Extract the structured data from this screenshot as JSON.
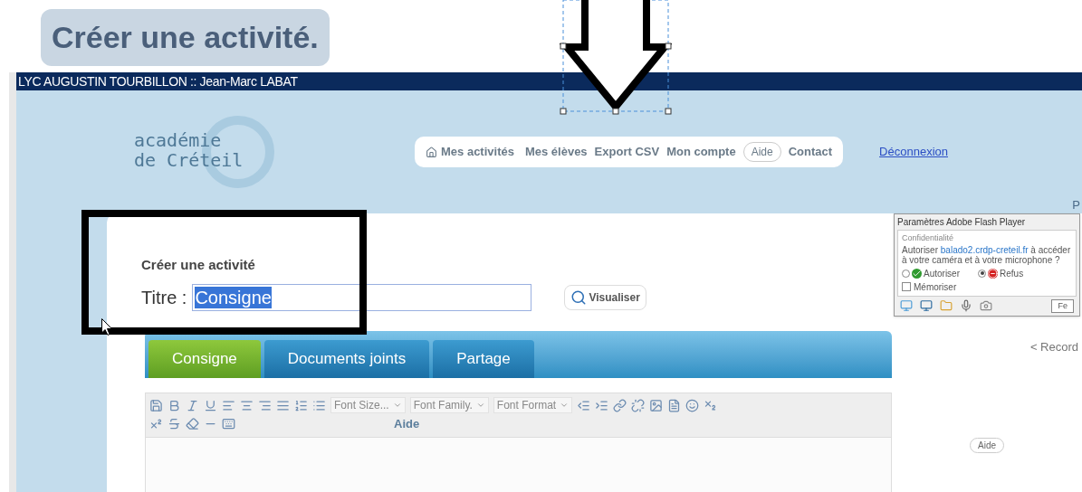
{
  "slide_title": "Créer une activité.",
  "window": {
    "title": "LYC AUGUSTIN TOURBILLON :: Jean-Marc LABAT"
  },
  "logo": {
    "line_1": "académie",
    "line_2": "de Créteil"
  },
  "nav": {
    "items": [
      {
        "label": "Mes activités",
        "kind": "home"
      },
      {
        "label": "Mes élèves",
        "kind": "plain"
      },
      {
        "label": "Export CSV",
        "kind": "plain"
      },
      {
        "label": "Mon compte",
        "kind": "plain"
      },
      {
        "label": "Aide",
        "kind": "pill"
      },
      {
        "label": "Contact",
        "kind": "plain"
      }
    ],
    "logout": "Déconnexion",
    "corner_text": "P"
  },
  "form": {
    "heading": "Créer une activité",
    "title_label": "Titre :",
    "title_value": "Consigne",
    "title_selected": true,
    "preview_button": "Visualiser"
  },
  "tabs": [
    {
      "label": "Consigne",
      "selected": true
    },
    {
      "label": "Documents joints",
      "selected": false
    },
    {
      "label": "Partage",
      "selected": false
    }
  ],
  "editor": {
    "dropdowns": [
      "Font Size...",
      "Font Family.",
      "Font Format"
    ],
    "help": "Aide"
  },
  "flash_dialog": {
    "title": "Paramètres Adobe Flash Player",
    "section": "Confidentialité",
    "question_start": "Autoriser",
    "site": "balado2.crdp-creteil.fr",
    "question_end": "à accéder à votre caméra et à votre microphone ?",
    "options": [
      {
        "label": "Autoriser",
        "selected": false,
        "kind": "allow"
      },
      {
        "label": "Refus",
        "selected": true,
        "kind": "deny"
      }
    ],
    "remember": {
      "label": "Mémoriser",
      "checked": false
    },
    "button": "Fe"
  },
  "side": {
    "record": "< Record",
    "help": "Aide"
  }
}
